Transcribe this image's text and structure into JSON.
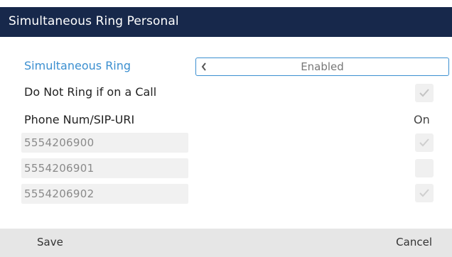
{
  "header": {
    "title": "Simultaneous Ring Personal"
  },
  "settings": {
    "simultaneous_ring": {
      "label": "Simultaneous Ring",
      "value": "Enabled"
    },
    "do_not_ring": {
      "label": "Do Not Ring if on a Call",
      "checked": true
    },
    "phone_num_header": {
      "label": "Phone Num/SIP-URI",
      "state_label": "On"
    },
    "numbers": [
      {
        "number": "5554206900",
        "checked": true
      },
      {
        "number": "5554206901",
        "checked": false
      },
      {
        "number": "5554206902",
        "checked": true
      }
    ]
  },
  "footer": {
    "save_label": "Save",
    "cancel_label": "Cancel"
  },
  "colors": {
    "title_bar": "#17284b",
    "accent": "#3b8fd0",
    "footer": "#e6e6e6"
  }
}
